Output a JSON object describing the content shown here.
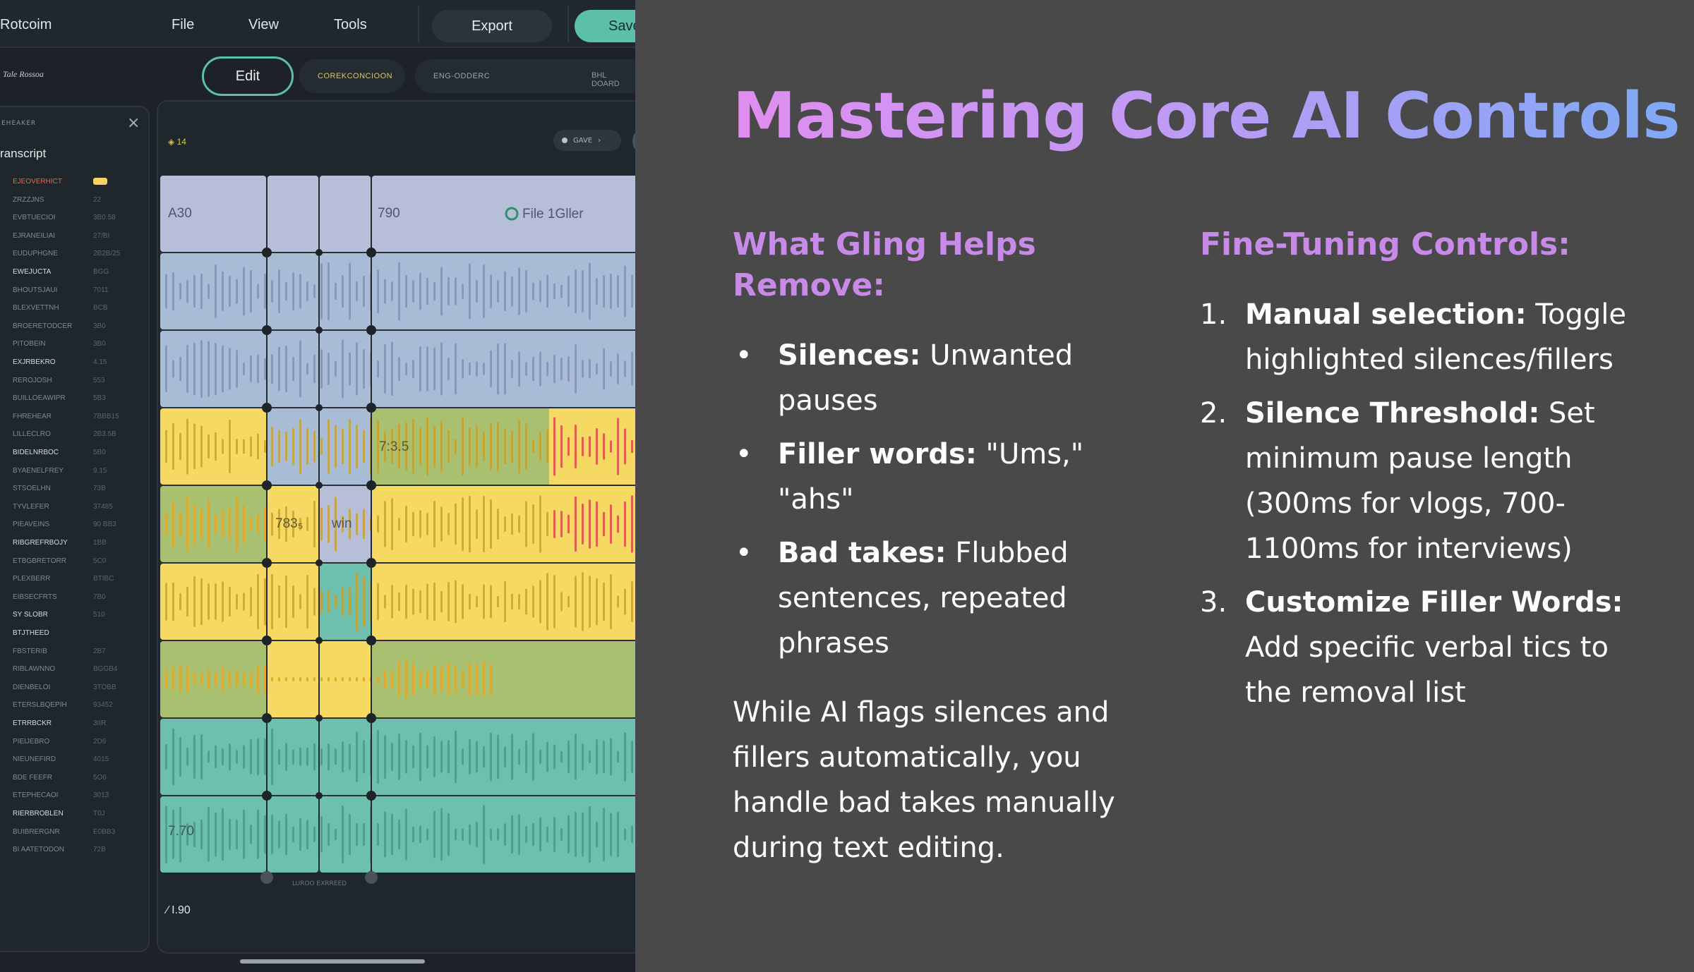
{
  "app": {
    "logo": "Rotcoim",
    "menu": [
      "File",
      "View",
      "Tools"
    ],
    "export_label": "Export",
    "save_label": "Save",
    "edit_label": "Edit",
    "toolbar_tabs": [
      "COREKCONCIOON",
      "ENG-ODDERC",
      "BHL DOARD"
    ],
    "project_name": "Tale Rossoa",
    "panel_small_title": "EHEAKER",
    "close_glyph": "×",
    "transcript_title": "ranscript",
    "transcript_rows": [
      {
        "name": "EJEOVERHICT",
        "val": ""
      },
      {
        "name": "ZRZZJNS",
        "val": "22"
      },
      {
        "name": "EVBTUECIOI",
        "val": "3B0.58"
      },
      {
        "name": "EJRANEILIAI",
        "val": "27/BI"
      },
      {
        "name": "EUDUPHGNE",
        "val": "2B2B/25"
      },
      {
        "name": "EWEJUCTA",
        "val": "BGG"
      },
      {
        "name": "BHOUTSJAUI",
        "val": "7011"
      },
      {
        "name": "BLEXVETTNH",
        "val": "BCB"
      },
      {
        "name": "BROERETODCER",
        "val": "3B0"
      },
      {
        "name": "PITOBEIN",
        "val": "3B0"
      },
      {
        "name": "EXJRBEKRO",
        "val": "4.15"
      },
      {
        "name": "REROJOSH",
        "val": "553"
      },
      {
        "name": "BUILLOEAWIPR",
        "val": "5B3"
      },
      {
        "name": "FHREHEAR",
        "val": "7BBB15"
      },
      {
        "name": "LILLECLRO",
        "val": "2B3.5B"
      },
      {
        "name": "BIDELNRBOC",
        "val": "5B0"
      },
      {
        "name": "BYAENELFREY",
        "val": "9.15"
      },
      {
        "name": "STSOELHN",
        "val": "73B"
      },
      {
        "name": "TYVLEFER",
        "val": "37485"
      },
      {
        "name": "PIEAVEINS",
        "val": "90 BB3"
      },
      {
        "name": "RIBGREFRBOJY",
        "val": "1BB"
      },
      {
        "name": "ETBGBRETORR",
        "val": "5C0"
      },
      {
        "name": "PLEXBERR",
        "val": "BTIBC"
      },
      {
        "name": "EIBSECFRTS",
        "val": "7B0"
      },
      {
        "name": "SY SLOBR",
        "val": "510"
      },
      {
        "name": "BTJTHEED",
        "val": ""
      },
      {
        "name": "FBSTERIB",
        "val": "2B7"
      },
      {
        "name": "RIBLAWNNO",
        "val": "BGGB4"
      },
      {
        "name": "DIENBELOI",
        "val": "3TOBB"
      },
      {
        "name": "ETERSLBQEPIH",
        "val": "93452"
      },
      {
        "name": "ETRRBCKR",
        "val": "3IIR"
      },
      {
        "name": "PIEIJEBRO",
        "val": "2D6"
      },
      {
        "name": "NIEUNEFIRD",
        "val": "4015"
      },
      {
        "name": "BDE FEEFR",
        "val": "5O6"
      },
      {
        "name": "ETEPHECAOI",
        "val": "3013"
      },
      {
        "name": "RIERBROBLEN",
        "val": "T0J"
      },
      {
        "name": "BUIBRERGNR",
        "val": "E0BB3"
      },
      {
        "name": "BI AATETODON",
        "val": "72B"
      }
    ],
    "editor_counter": "◈ 14",
    "editor_gave": "GAVE",
    "editor_footer": "⁄ I.90",
    "editor_sublabel": "LUROO EXRREED",
    "wave_labels": {
      "a30": "A30",
      "n790": "790",
      "filler": "File 1Gller",
      "n735": "7:3.5",
      "n7835": "783₅",
      "win": "win",
      "n770": "7.70"
    },
    "colors": {
      "lavender": "#b7bfd8",
      "blue": "#a8bcd6",
      "yellow": "#f5d963",
      "green": "#a8c070",
      "teal": "#6fbfad",
      "accent": "#5cbfa8"
    }
  },
  "slide": {
    "title": "Mastering Core AI Controls",
    "left_heading": "What Gling Helps Remove:",
    "bullets": [
      {
        "term": "Silences:",
        "desc": " Unwanted pauses"
      },
      {
        "term": "Filler words:",
        "desc": " \"Ums,\" \"ahs\""
      },
      {
        "term": "Bad takes:",
        "desc": " Flubbed sentences, repeated phrases"
      }
    ],
    "summary": "While AI flags silences and fillers automatically, you handle bad takes manually during text editing.",
    "right_heading": "Fine-Tuning Controls:",
    "steps": [
      {
        "num": "1.",
        "term": "Manual selection:",
        "desc": " Toggle highlighted silences/fillers"
      },
      {
        "num": "2.",
        "term": "Silence Threshold:",
        "desc": " Set minimum pause length (300ms for vlogs, 700-1100ms for interviews)"
      },
      {
        "num": "3.",
        "term": "Customize Filler Words:",
        "desc": " Add specific verbal tics to the removal list"
      }
    ]
  }
}
